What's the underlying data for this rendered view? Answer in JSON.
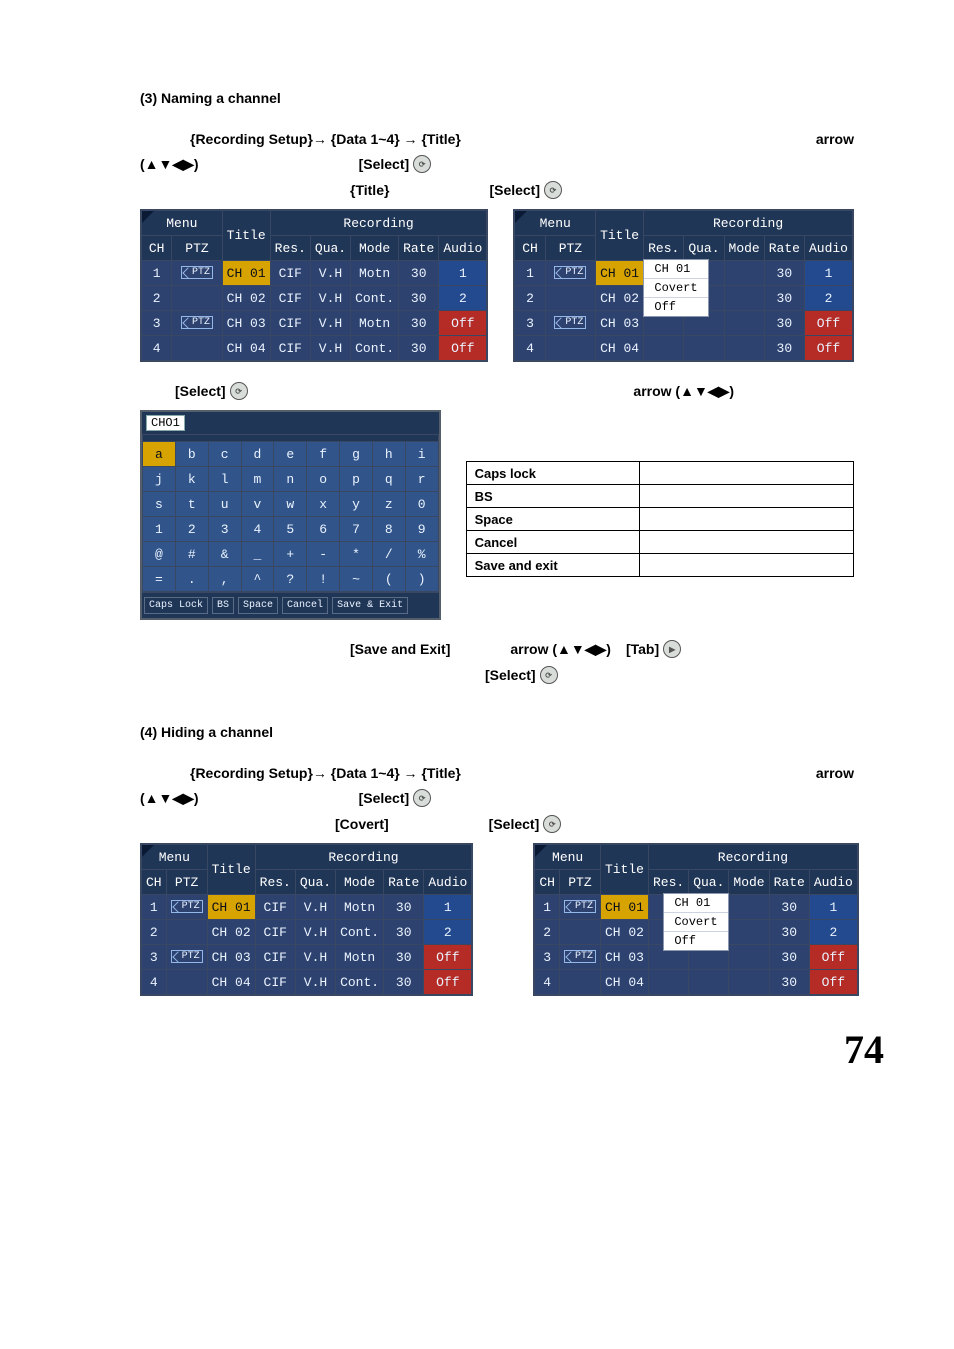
{
  "page_number": "74",
  "section3": {
    "title": "(3) Naming a channel",
    "instr1_left": "{Recording Setup}→ {Data 1~4} → {Title}",
    "instr1_right": "arrow",
    "instr1_below_left": "(▲▼◀▶)",
    "instr1_below_mid": "[Select]",
    "instr2_left": "{Title}",
    "instr2_right": "[Select]",
    "instr3_left": "[Select]",
    "instr3_right": "arrow (▲▼◀▶)",
    "instr4_mid": "[Save and Exit]",
    "instr4_right": "arrow (▲▼◀▶)",
    "instr4_tab": "[Tab]",
    "instr5_mid": "[Select]"
  },
  "section4": {
    "title": "(4) Hiding a channel",
    "instr1_left": "{Recording Setup}→ {Data 1~4} → {Title}",
    "instr1_right": "arrow",
    "instr1_below_left": "(▲▼◀▶)",
    "instr1_below_mid": "[Select]",
    "instr2_left": "[Covert]",
    "instr2_right": "[Select]"
  },
  "dvr": {
    "menu": "Menu",
    "ch": "CH",
    "ptz": "PTZ",
    "title": "Title",
    "recording": "Recording",
    "cols": {
      "res": "Res.",
      "qua": "Qua.",
      "mode": "Mode",
      "rate": "Rate",
      "audio": "Audio"
    },
    "rows": [
      {
        "ch": "1",
        "ptz": true,
        "title": "CH 01",
        "res": "CIF",
        "qua": "V.H",
        "mode": "Motn",
        "rate": "30",
        "audio": "1"
      },
      {
        "ch": "2",
        "ptz": false,
        "title": "CH 02",
        "res": "CIF",
        "qua": "V.H",
        "mode": "Cont.",
        "rate": "30",
        "audio": "2"
      },
      {
        "ch": "3",
        "ptz": true,
        "title": "CH 03",
        "res": "CIF",
        "qua": "V.H",
        "mode": "Motn",
        "rate": "30",
        "audio": "Off"
      },
      {
        "ch": "4",
        "ptz": false,
        "title": "CH 04",
        "res": "CIF",
        "qua": "V.H",
        "mode": "Cont.",
        "rate": "30",
        "audio": "Off"
      }
    ],
    "dropdown": {
      "opt1": "CH 01",
      "opt2": "Covert",
      "opt3": "Off"
    }
  },
  "keyboard": {
    "titlebox": "CHO1",
    "rows": [
      [
        "a",
        "b",
        "c",
        "d",
        "e",
        "f",
        "g",
        "h",
        "i"
      ],
      [
        "j",
        "k",
        "l",
        "m",
        "n",
        "o",
        "p",
        "q",
        "r"
      ],
      [
        "s",
        "t",
        "u",
        "v",
        "w",
        "x",
        "y",
        "z",
        "0"
      ],
      [
        "1",
        "2",
        "3",
        "4",
        "5",
        "6",
        "7",
        "8",
        "9"
      ],
      [
        "@",
        "#",
        "&",
        "_",
        "+",
        "-",
        "*",
        "/",
        "%"
      ],
      [
        "=",
        ".",
        ",",
        "^",
        "?",
        "!",
        "~",
        "(",
        ")"
      ]
    ],
    "foot": {
      "caps": "Caps Lock",
      "bs": "BS",
      "space": "Space",
      "cancel": "Cancel",
      "save": "Save & Exit"
    }
  },
  "legend": {
    "caps": "Caps lock",
    "bs": "BS",
    "space": "Space",
    "cancel": "Cancel",
    "save": "Save and exit"
  }
}
